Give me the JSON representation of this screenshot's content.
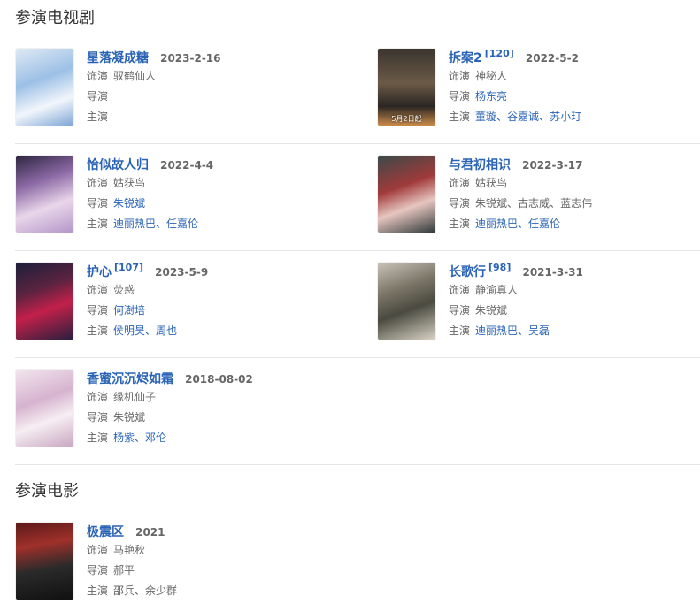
{
  "sections": {
    "tv_title": "参演电视剧",
    "movie_title": "参演电影"
  },
  "labels": {
    "role": "饰演",
    "director": "导演",
    "cast": "主演"
  },
  "tv": [
    {
      "title": "星落凝成糖",
      "sup": "",
      "date": "2023-2-16",
      "role": "驭鹤仙人",
      "director": [],
      "cast": []
    },
    {
      "title": "拆案2",
      "sup": "[120]",
      "date": "2022-5-2",
      "role": "神秘人",
      "director": [
        "杨东亮"
      ],
      "cast": [
        "董璇",
        "谷嘉诚",
        "苏小玎"
      ],
      "poster_text": "5月2日起"
    },
    {
      "title": "恰似故人归",
      "sup": "",
      "date": "2022-4-4",
      "role": "姑获鸟",
      "director": [
        "朱锐斌"
      ],
      "cast": [
        "迪丽热巴",
        "任嘉伦"
      ]
    },
    {
      "title": "与君初相识",
      "sup": "",
      "date": "2022-3-17",
      "role": "姑获鸟",
      "director": [
        "朱锐斌",
        "古志威",
        "蓝志伟"
      ],
      "cast": [
        "迪丽热巴",
        "任嘉伦"
      ]
    },
    {
      "title": "护心",
      "sup": "[107]",
      "date": "2023-5-9",
      "role": "荧惑",
      "director": [
        "何澍培"
      ],
      "cast": [
        "侯明昊",
        "周也"
      ]
    },
    {
      "title": "长歌行",
      "sup": "[98]",
      "date": "2021-3-31",
      "role": "静渝真人",
      "director": [
        "朱锐斌"
      ],
      "cast": [
        "迪丽热巴",
        "吴磊"
      ]
    },
    {
      "title": "香蜜沉沉烬如霜",
      "sup": "",
      "date": "2018-08-02",
      "role": "缘机仙子",
      "director": [
        "朱锐斌"
      ],
      "cast": [
        "杨紫",
        "邓伦"
      ]
    }
  ],
  "movies": [
    {
      "title": "极震区",
      "sup": "",
      "date": "2021",
      "role": "马艳秋",
      "director": [
        "郝平"
      ],
      "cast": [
        "邵兵",
        "余少群"
      ]
    }
  ],
  "colors": {
    "link": "#2a63b5",
    "muted": "#666666",
    "divider": "#e5e5e5"
  }
}
